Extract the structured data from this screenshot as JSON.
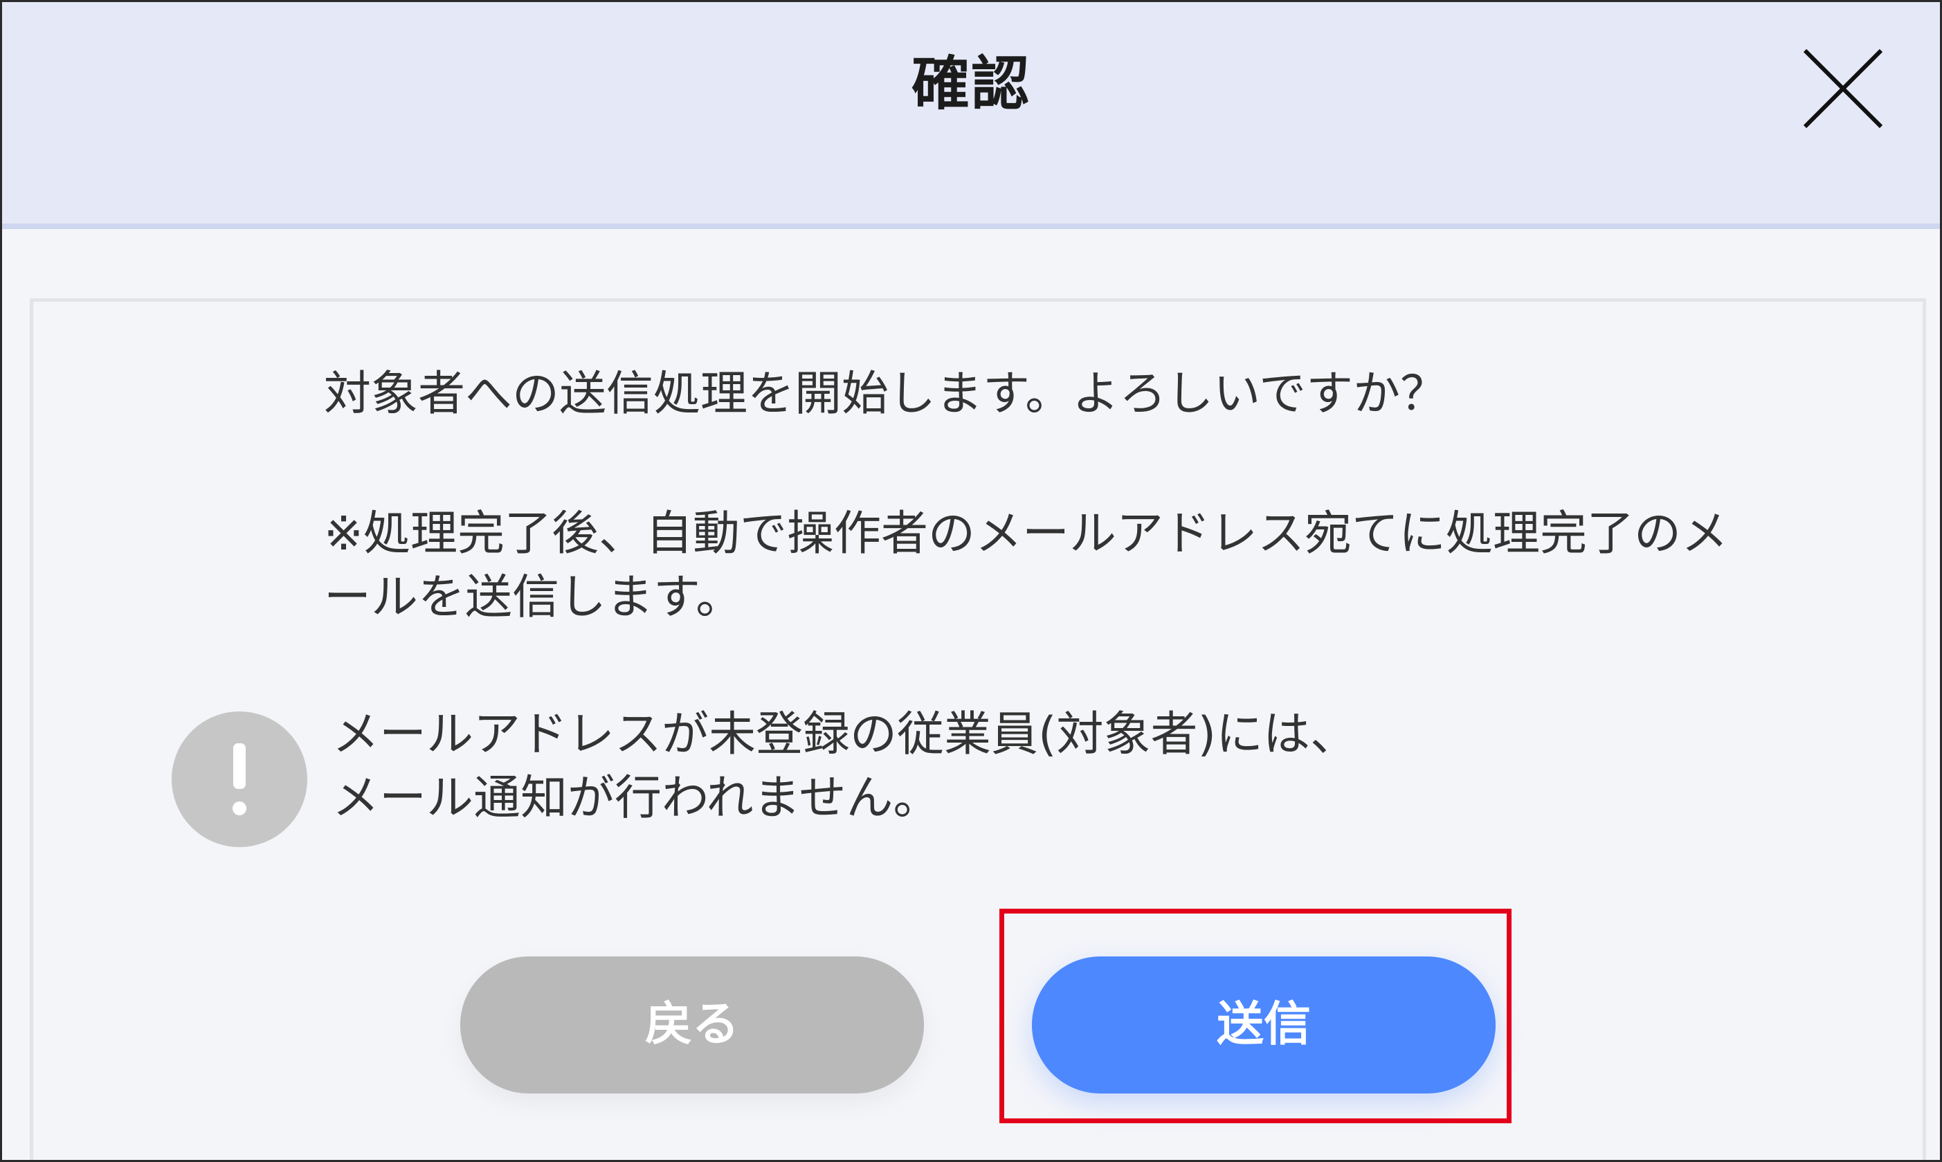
{
  "dialog": {
    "title": "確認",
    "close_icon": "close-icon",
    "message_main": "対象者への送信処理を開始します。よろしいですか？",
    "message_note_line1": "※処理完了後、自動で操作者のメールアドレス宛てに処理完了のメ",
    "message_note_line2": "ールを送信します。",
    "warning_icon": "exclamation-circle-icon",
    "warning_line1": "メールアドレスが未登録の従業員(対象者)には、",
    "warning_line2": "メール通知が行われません。",
    "back_label": "戻る",
    "send_label": "送信"
  },
  "colors": {
    "header_background": "#e5e8f6",
    "body_background": "#f4f5f9",
    "primary_button": "#4d88ff",
    "secondary_button": "#b9b9b9",
    "highlight_frame": "#e3001b",
    "warning_icon": "#c6c6c6"
  }
}
